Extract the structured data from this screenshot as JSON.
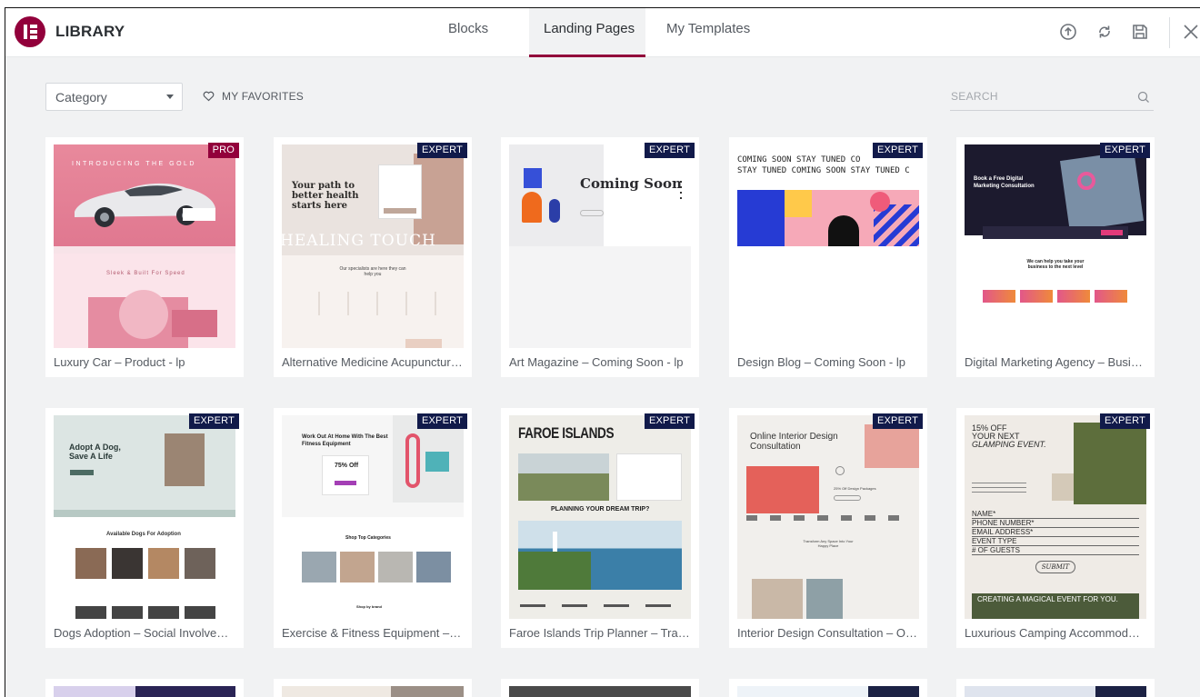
{
  "header": {
    "brand": "LIBRARY",
    "tabs": [
      {
        "label": "Blocks",
        "active": false
      },
      {
        "label": "Landing Pages",
        "active": true
      },
      {
        "label": "My Templates",
        "active": false
      }
    ],
    "icons": [
      "upload-icon",
      "sync-icon",
      "save-icon",
      "close-icon"
    ],
    "accent_color": "#92003b"
  },
  "filters": {
    "category_value": "Category",
    "favorites_label": "MY FAVORITES",
    "search_placeholder": "SEARCH"
  },
  "templates": [
    {
      "title": "Luxury Car – Product - lp",
      "badge": "PRO"
    },
    {
      "title": "Alternative Medicine Acupuncture...",
      "badge": "EXPERT"
    },
    {
      "title": "Art Magazine – Coming Soon - lp",
      "badge": "EXPERT"
    },
    {
      "title": "Design Blog – Coming Soon - lp",
      "badge": "EXPERT"
    },
    {
      "title": "Digital Marketing Agency – Busin...",
      "badge": "EXPERT"
    },
    {
      "title": "Dogs Adoption – Social Involvem...",
      "badge": "EXPERT"
    },
    {
      "title": "Exercise & Fitness Equipment – e...",
      "badge": "EXPERT"
    },
    {
      "title": "Faroe Islands Trip Planner – Trave...",
      "badge": "EXPERT"
    },
    {
      "title": "Interior Design Consultation – Onl...",
      "badge": "EXPERT"
    },
    {
      "title": "Luxurious Camping Accommodati...",
      "badge": "EXPERT"
    }
  ],
  "thumb_text": {
    "car": {
      "headline": "INTRODUCING THE GOLD",
      "sub": "Sleek & Built For Speed"
    },
    "med": {
      "headline": "Your path to better health starts here",
      "banner": "HEALING TOUCH",
      "sub": "Our specialists are here they can help you"
    },
    "art": {
      "headline": "Coming Soon"
    },
    "blog": {
      "ticker1": "COMING SOON STAY TUNED CO",
      "ticker2": "STAY TUNED COMING SOON STAY TUNED C"
    },
    "mkt": {
      "headline": "Book a Free Digital Marketing Consultation",
      "sub": "We can help you take your business to the next level"
    },
    "dog": {
      "headline": "Adopt A Dog, Save A Life",
      "sub": "Available Dogs For Adoption"
    },
    "fit": {
      "headline": "Work Out At Home With The Best Fitness Equipment",
      "offer": "75% Off",
      "sub": "Shop Top Categories",
      "foot": "Shop by brand"
    },
    "faroe": {
      "headline": "FAROE ISLANDS",
      "sub": "PLANNING YOUR DREAM TRIP?"
    },
    "int": {
      "headline": "Online Interior Design Consultation",
      "offer": "25% Off Design Packages",
      "sub": "Transform Any Space Into Your Happy Place"
    },
    "camp": {
      "headline1": "15% OFF",
      "headline2": "YOUR NEXT",
      "headline3": "GLAMPING EVENT.",
      "fields": [
        "NAME*",
        "PHONE NUMBER*",
        "EMAIL ADDRESS*",
        "EVENT TYPE",
        "# OF GUESTS"
      ],
      "button": "SUBMIT",
      "banner": "CREATING A MAGICAL EVENT FOR YOU."
    }
  }
}
